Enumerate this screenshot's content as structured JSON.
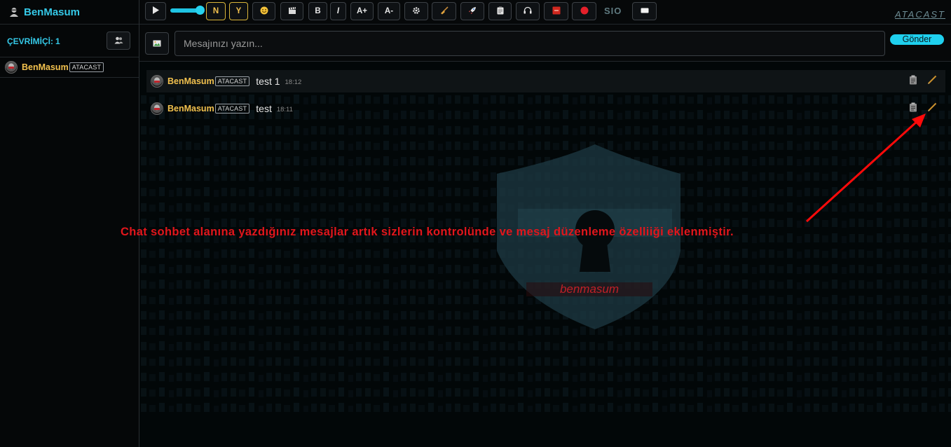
{
  "sidebar": {
    "title": "BenMasum",
    "online_label": "ÇEVRİMİÇİ:",
    "online_count": "1",
    "users": [
      {
        "name": "BenMasum",
        "tag": "ATACAST"
      }
    ]
  },
  "toolbar": {
    "play_icon": "play-icon",
    "volume_level": 1.0,
    "n_label": "N",
    "y_label": "Y",
    "bold_label": "B",
    "italic_label": "I",
    "font_up_label": "A+",
    "font_down_label": "A-",
    "sio_label": "SIO",
    "logo_text": "ATACAST"
  },
  "input": {
    "placeholder": "Mesajınızı yazın...",
    "send_label": "Gönder"
  },
  "messages": [
    {
      "user": "BenMasum",
      "tag": "ATACAST",
      "text": "test 1",
      "time": "18:12"
    },
    {
      "user": "BenMasum",
      "tag": "ATACAST",
      "text": "test",
      "time": "18:11"
    }
  ],
  "background": {
    "shield_text": "benmasum"
  },
  "annotation": {
    "text": "Chat sohbet alanına yazdığınız mesajlar artık sizlerin kontrolünde ve mesaj düzenleme özelliiği eklenmiştir."
  },
  "colors": {
    "accent": "#1fd0ee",
    "username": "#f2c14e",
    "annotation": "#e2161c"
  }
}
